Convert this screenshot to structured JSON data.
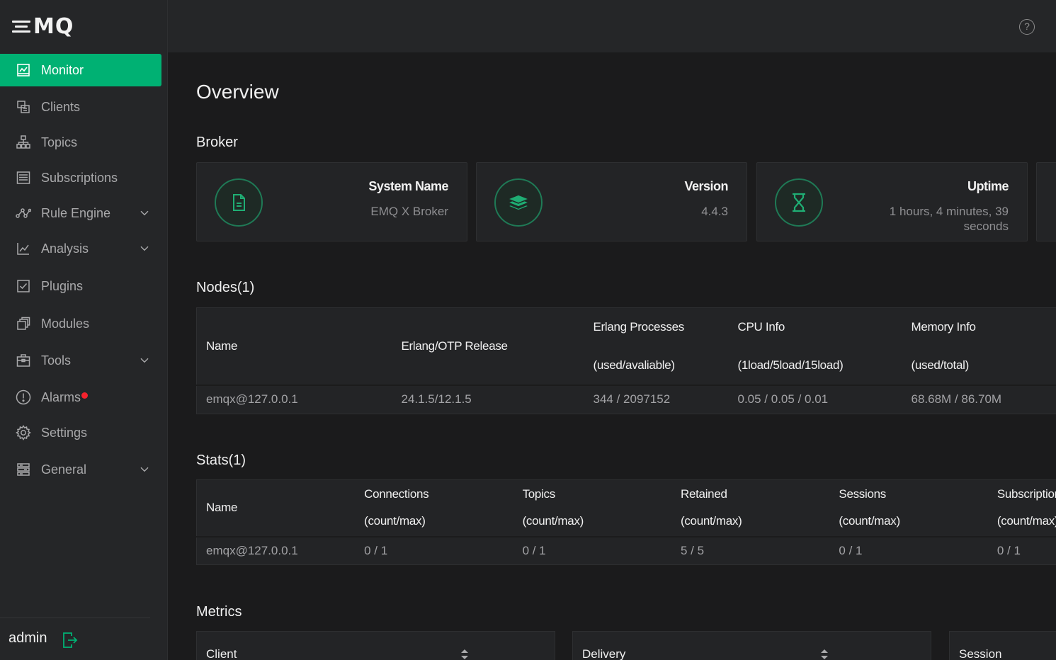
{
  "brand": {
    "logo_text": "MQ"
  },
  "sidebar": {
    "items": [
      {
        "label": "Monitor"
      },
      {
        "label": "Clients"
      },
      {
        "label": "Topics"
      },
      {
        "label": "Subscriptions"
      },
      {
        "label": "Rule Engine"
      },
      {
        "label": "Analysis"
      },
      {
        "label": "Plugins"
      },
      {
        "label": "Modules"
      },
      {
        "label": "Tools"
      },
      {
        "label": "Alarms"
      },
      {
        "label": "Settings"
      },
      {
        "label": "General"
      }
    ],
    "user": "admin"
  },
  "header": {
    "help_glyph": "?"
  },
  "main": {
    "title": "Overview",
    "broker_title": "Broker",
    "cards": [
      {
        "label": "System Name",
        "value": "EMQ X Broker",
        "icon": "file-icon"
      },
      {
        "label": "Version",
        "value": "4.4.3",
        "icon": "layers-icon"
      },
      {
        "label": "Uptime",
        "value": "1 hours, 4 minutes, 39 seconds",
        "icon": "hourglass-icon"
      }
    ],
    "nodes_title": "Nodes(1)",
    "nodes_table": {
      "headers": [
        {
          "line1": "Name",
          "line2": ""
        },
        {
          "line1": "Erlang/OTP Release",
          "line2": ""
        },
        {
          "line1": "Erlang Processes",
          "line2": "(used/avaliable)"
        },
        {
          "line1": "CPU Info",
          "line2": "(1load/5load/15load)"
        },
        {
          "line1": "Memory Info",
          "line2": "(used/total)"
        }
      ],
      "row": [
        "emqx@127.0.0.1",
        "24.1.5/12.1.5",
        "344 / 2097152",
        "0.05 / 0.05 / 0.01",
        "68.68M / 86.70M"
      ]
    },
    "stats_title": "Stats(1)",
    "stats_table": {
      "headers": [
        {
          "line1": "Name",
          "line2": ""
        },
        {
          "line1": "Connections",
          "line2": "(count/max)"
        },
        {
          "line1": "Topics",
          "line2": "(count/max)"
        },
        {
          "line1": "Retained",
          "line2": "(count/max)"
        },
        {
          "line1": "Sessions",
          "line2": "(count/max)"
        },
        {
          "line1": "Subscriptions",
          "line2": "(count/max)"
        }
      ],
      "row": [
        "emqx@127.0.0.1",
        "0 / 1",
        "0 / 1",
        "5 / 5",
        "0 / 1",
        "0 / 1"
      ]
    },
    "metrics_title": "Metrics",
    "metrics": [
      {
        "label": "Client"
      },
      {
        "label": "Delivery"
      },
      {
        "label": "Session"
      }
    ]
  },
  "colors": {
    "accent": "#00b173",
    "alarm": "#f5222d",
    "sidebar_bg": "#252628",
    "main_bg": "#1b1b1c"
  }
}
